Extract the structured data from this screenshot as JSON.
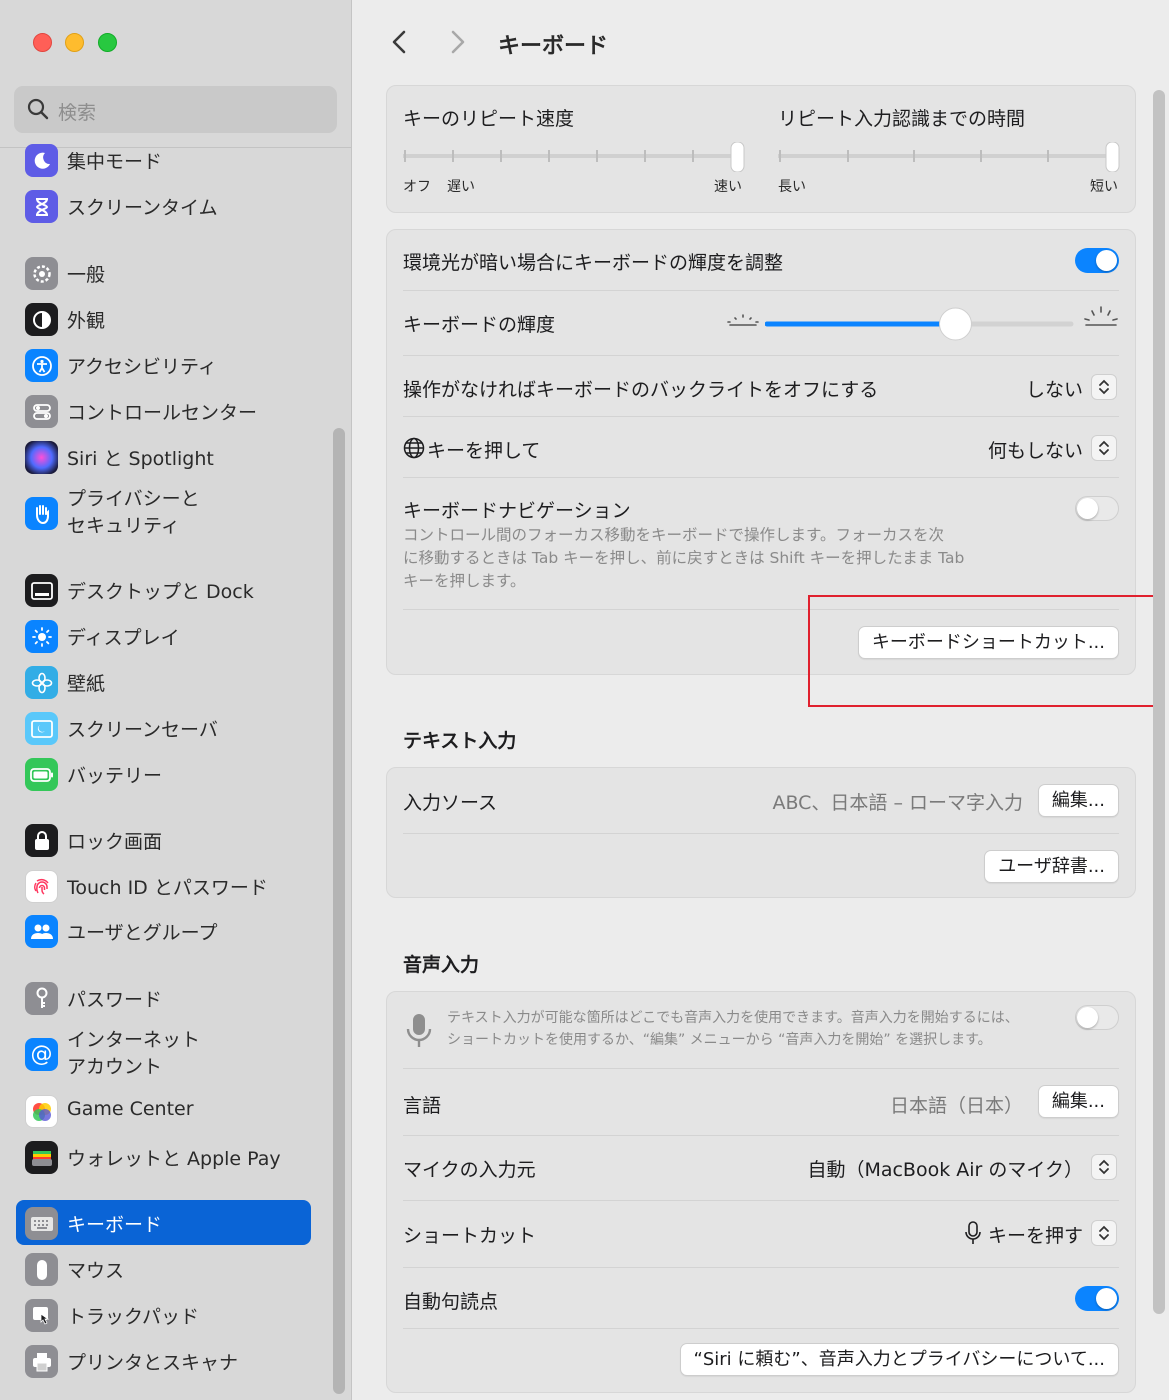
{
  "sidebar": {
    "search_placeholder": "検索",
    "items": [
      {
        "label": "集中モード",
        "icon": "moon-icon",
        "color": "#5e5ce6"
      },
      {
        "label": "スクリーンタイム",
        "icon": "hourglass-icon",
        "color": "#5e5ce6"
      },
      {
        "label": "一般",
        "icon": "gear-icon",
        "color": "#8e8e93"
      },
      {
        "label": "外観",
        "icon": "appearance-icon",
        "color": "#1c1c1e"
      },
      {
        "label": "アクセシビリティ",
        "icon": "accessibility-icon",
        "color": "#0a84ff"
      },
      {
        "label": "コントロールセンター",
        "icon": "control-center-icon",
        "color": "#8e8e93"
      },
      {
        "label": "Siri と Spotlight",
        "icon": "siri-icon",
        "color": "#3a3a8c"
      },
      {
        "label": "プライバシーと\nセキュリティ",
        "icon": "hand-icon",
        "color": "#0a84ff"
      },
      {
        "label": "デスクトップと Dock",
        "icon": "desktop-dock-icon",
        "color": "#1c1c1e"
      },
      {
        "label": "ディスプレイ",
        "icon": "display-icon",
        "color": "#0a84ff"
      },
      {
        "label": "壁紙",
        "icon": "wallpaper-icon",
        "color": "#32ade6"
      },
      {
        "label": "スクリーンセーバ",
        "icon": "screensaver-icon",
        "color": "#5ac8fa"
      },
      {
        "label": "バッテリー",
        "icon": "battery-icon",
        "color": "#34c759"
      },
      {
        "label": "ロック画面",
        "icon": "lock-screen-icon",
        "color": "#1c1c1e"
      },
      {
        "label": "Touch ID とパスワード",
        "icon": "fingerprint-icon",
        "color": "#ffffff"
      },
      {
        "label": "ユーザとグループ",
        "icon": "users-icon",
        "color": "#0a84ff"
      },
      {
        "label": "パスワード",
        "icon": "key-icon",
        "color": "#8e8e93"
      },
      {
        "label": "インターネット\nアカウント",
        "icon": "at-icon",
        "color": "#0a84ff"
      },
      {
        "label": "Game Center",
        "icon": "game-center-icon",
        "color": "#ffffff"
      },
      {
        "label": "ウォレットと Apple Pay",
        "icon": "wallet-icon",
        "color": "#1c1c1e"
      },
      {
        "label": "キーボード",
        "icon": "keyboard-icon",
        "color": "#8e8e93"
      },
      {
        "label": "マウス",
        "icon": "mouse-icon",
        "color": "#8e8e93"
      },
      {
        "label": "トラックパッド",
        "icon": "trackpad-icon",
        "color": "#8e8e93"
      },
      {
        "label": "プリンタとスキャナ",
        "icon": "printer-icon",
        "color": "#8e8e93"
      }
    ]
  },
  "header": {
    "title": "キーボード"
  },
  "repeat": {
    "repeat_rate_label": "キーのリピート速度",
    "repeat_rate_min_a": "オフ",
    "repeat_rate_min_b": "遅い",
    "repeat_rate_max": "速い",
    "repeat_rate_value": 1.0,
    "delay_label": "リピート入力認識までの時間",
    "delay_min": "長い",
    "delay_max": "短い",
    "delay_value": 1.0
  },
  "backlight": {
    "auto_brightness_label": "環境光が暗い場合にキーボードの輝度を調整",
    "auto_brightness_on": true,
    "brightness_label": "キーボードの輝度",
    "brightness_value": 0.62,
    "backlight_off_label": "操作がなければキーボードのバックライトをオフにする",
    "backlight_off_value": "しない",
    "globe_label": "キーを押して",
    "globe_value": "何もしない",
    "nav_label": "キーボードナビゲーション",
    "nav_on": false,
    "nav_desc_1": "コントロール間のフォーカス移動をキーボードで操作します。フォーカスを次",
    "nav_desc_2": "に移動するときは Tab キーを押し、前に戻すときは Shift キーを押したまま Tab",
    "nav_desc_3": "キーを押します。",
    "shortcuts_button": "キーボードショートカット..."
  },
  "text_input": {
    "section_title": "テキスト入力",
    "sources_label": "入力ソース",
    "sources_value": "ABC、日本語 – ローマ字入力",
    "edit_button": "編集...",
    "dictionary_button": "ユーザ辞書..."
  },
  "dictation": {
    "section_title": "音声入力",
    "desc_1": "テキスト入力が可能な箇所はどこでも音声入力を使用できます。音声入力を開始するには、",
    "desc_2": "ショートカットを使用するか、“編集” メニューから “音声入力を開始” を選択します。",
    "dictation_on": false,
    "language_label": "言語",
    "language_value": "日本語（日本）",
    "edit_button": "編集...",
    "mic_label": "マイクの入力元",
    "mic_value": "自動（MacBook Air のマイク）",
    "shortcut_label": "ショートカット",
    "shortcut_value": "キーを押す",
    "punct_label": "自動句読点",
    "punct_on": true,
    "privacy_button": "“Siri に頼む”、音声入力とプライバシーについて..."
  },
  "colors": {
    "accent": "#0b84ff",
    "highlight_box": "#e0202e",
    "sidebar_active": "#0a64d6"
  }
}
